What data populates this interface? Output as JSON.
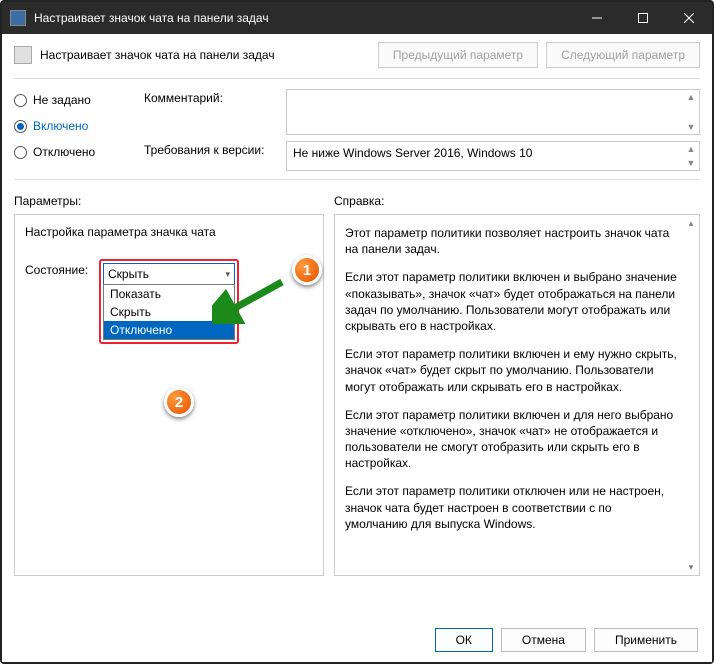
{
  "window": {
    "title": "Настраивает значок чата на панели задач"
  },
  "subheader": {
    "title": "Настраивает значок чата на панели задач",
    "prev": "Предыдущий параметр",
    "next": "Следующий параметр"
  },
  "radios": {
    "not_set": "Не задано",
    "enabled": "Включено",
    "disabled": "Отключено",
    "selected": "enabled"
  },
  "fields": {
    "comment_label": "Комментарий:",
    "comment_value": "",
    "version_label": "Требования к версии:",
    "version_value": "Не ниже Windows Server 2016, Windows 10"
  },
  "sections": {
    "params_label": "Параметры:",
    "help_label": "Справка:"
  },
  "params_panel": {
    "title": "Настройка параметра значка чата",
    "state_label": "Состояние:",
    "selected": "Скрыть",
    "options": [
      "Показать",
      "Скрыть",
      "Отключено"
    ],
    "highlighted": "Отключено"
  },
  "help": {
    "p1": "Этот параметр политики позволяет настроить значок чата на панели задач.",
    "p2": "Если этот параметр политики включен и выбрано значение «показывать», значок «чат» будет отображаться на панели задач по умолчанию. Пользователи могут отображать или скрывать его в настройках.",
    "p3": "Если этот параметр политики включен и ему нужно скрыть, значок «чат» будет скрыт по умолчанию. Пользователи могут отображать или скрывать его в настройках.",
    "p4": "Если этот параметр политики включен и для него выбрано значение «отключено», значок «чат» не отображается и пользователи не смогут отобразить или скрыть его в настройках.",
    "p5": "Если этот параметр политики отключен или не настроен, значок чата будет настроен в соответствии с по умолчанию для выпуска Windows."
  },
  "footer": {
    "ok": "ОК",
    "cancel": "Отмена",
    "apply": "Применить"
  },
  "annotations": {
    "b1": "1",
    "b2": "2"
  }
}
